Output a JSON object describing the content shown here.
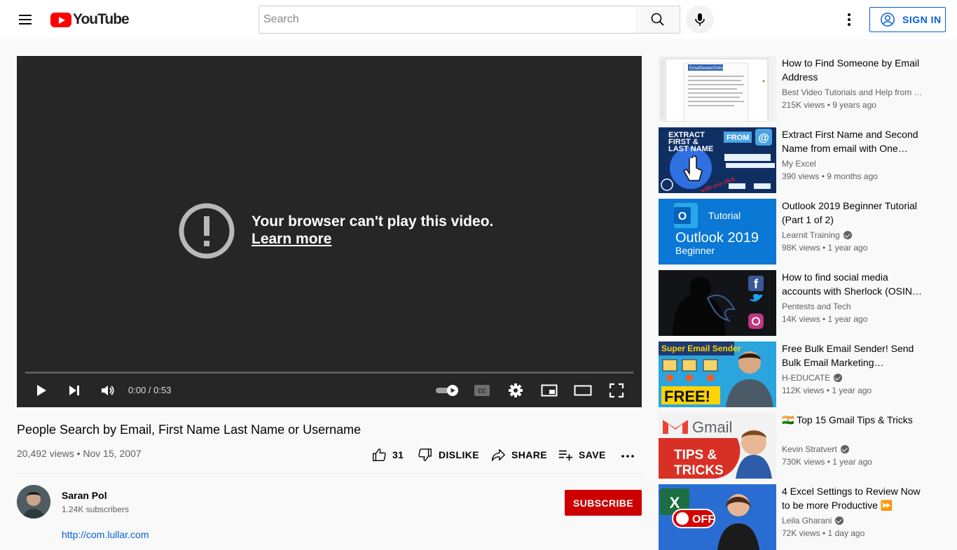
{
  "header": {
    "logo_text": "YouTube",
    "search_placeholder": "Search",
    "sign_in_label": "SIGN IN"
  },
  "player": {
    "error_message": "Your browser can't play this video.",
    "learn_more": "Learn more",
    "time_display": "0:00 / 0:53",
    "progress": 0
  },
  "video": {
    "title": "People Search by Email, First Name Last Name or Username",
    "views_date": "20,492 views • Nov 15, 2007",
    "like_count": "31",
    "dislike_label": "DISLIKE",
    "share_label": "SHARE",
    "save_label": "SAVE"
  },
  "channel": {
    "name": "Saran Pol",
    "subscribers": "1.24K subscribers",
    "subscribe_label": "SUBSCRIBE",
    "description_link": "http://com.lullar.com"
  },
  "recommendations": [
    {
      "title": "How to Find Someone by Email Address",
      "channel": "Best Video Tutorials and Help from …",
      "verified": false,
      "meta": "215K views • 9 years ago"
    },
    {
      "title": "Extract First Name and Second Name from email with One…",
      "channel": "My Excel",
      "verified": false,
      "meta": "390 views • 9 months ago"
    },
    {
      "title": "Outlook 2019 Beginner Tutorial (Part 1 of 2)",
      "channel": "Learnit Training",
      "verified": true,
      "meta": "98K views • 1 year ago"
    },
    {
      "title": "How to find social media accounts with Sherlock (OSIN…",
      "channel": "Pentests and Tech",
      "verified": false,
      "meta": "14K views • 1 year ago"
    },
    {
      "title": "Free Bulk Email Sender! Send Bulk Email Marketing…",
      "channel": "H-EDUCATE",
      "verified": true,
      "meta": "112K views • 1 year ago"
    },
    {
      "title": "🇮🇳 Top 15 Gmail Tips & Tricks",
      "channel": "Kevin Stratvert",
      "verified": true,
      "meta": "730K views • 1 year ago"
    },
    {
      "title": "4 Excel Settings to Review Now to be more Productive ⏩",
      "channel": "Leila Gharani",
      "verified": true,
      "meta": "72K views • 1 day ago"
    }
  ],
  "thumbnails": {
    "t1": "EmailSeekerOnline",
    "t2_line1": "EXTRACT",
    "t2_line2": "FIRST &",
    "t2_line3": "LAST NAME",
    "t2_from": "FROM",
    "t2_at": "@",
    "t2_script": "with one click",
    "t3_brand": "Tutorial",
    "t3_title": "Outlook 2019",
    "t3_sub": "Beginner",
    "t5_top": "Super Email Sender",
    "t5_free": "FREE!",
    "t6_brand": "Gmail",
    "t6_tips": "TIPS &",
    "t6_tricks": "TRICKS",
    "t7_off": "OFF"
  }
}
